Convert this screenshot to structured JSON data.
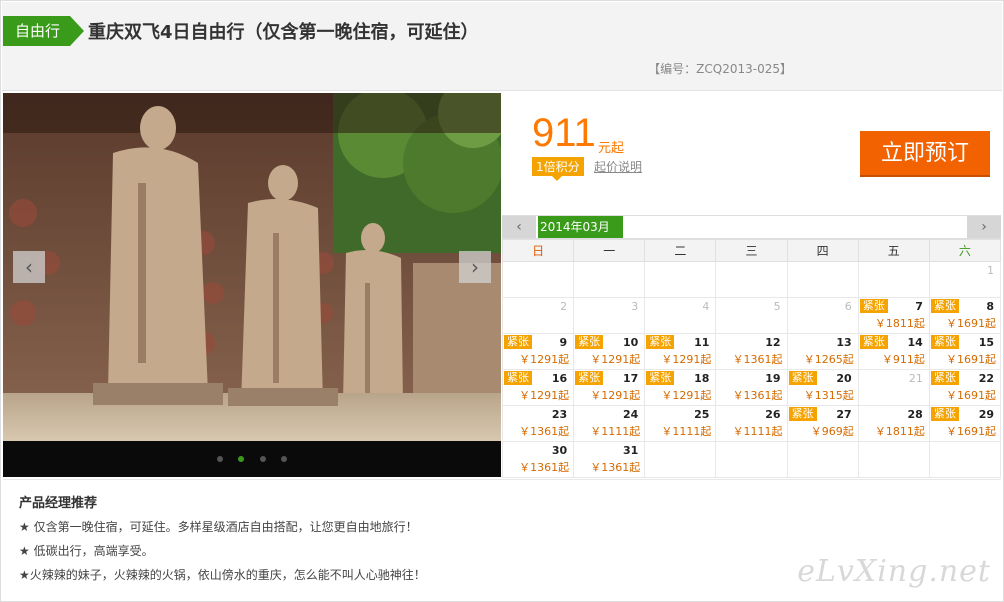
{
  "header": {
    "tag": "自由行",
    "title": "重庆双飞4日自由行（仅含第一晚住宿，可延住）",
    "code": "【编号：ZCQ2013-025】"
  },
  "gallery": {
    "prev_label": "‹",
    "next_label": "›",
    "dots": 4,
    "active_dot": 2
  },
  "price": {
    "amount": "911",
    "unit": "元起",
    "points": "1倍积分",
    "note": "起价说明",
    "book_label": "立即预订"
  },
  "calendar": {
    "prev": "‹",
    "next": "›",
    "month": "2014年03月",
    "weekdays": [
      "日",
      "一",
      "二",
      "三",
      "四",
      "五",
      "六"
    ],
    "tight_label": "紧张",
    "rows": [
      [
        null,
        null,
        null,
        null,
        null,
        null,
        {
          "day": "1",
          "off": true
        }
      ],
      [
        {
          "day": "2",
          "off": true
        },
        {
          "day": "3",
          "off": true
        },
        {
          "day": "4",
          "off": true
        },
        {
          "day": "5",
          "off": true
        },
        {
          "day": "6",
          "off": true
        },
        {
          "day": "7",
          "tight": true,
          "price": "￥1811起"
        },
        {
          "day": "8",
          "tight": true,
          "price": "￥1691起"
        }
      ],
      [
        {
          "day": "9",
          "tight": true,
          "price": "￥1291起"
        },
        {
          "day": "10",
          "tight": true,
          "price": "￥1291起"
        },
        {
          "day": "11",
          "tight": true,
          "price": "￥1291起"
        },
        {
          "day": "12",
          "price": "￥1361起"
        },
        {
          "day": "13",
          "price": "￥1265起"
        },
        {
          "day": "14",
          "tight": true,
          "price": "￥911起"
        },
        {
          "day": "15",
          "tight": true,
          "price": "￥1691起"
        }
      ],
      [
        {
          "day": "16",
          "tight": true,
          "price": "￥1291起"
        },
        {
          "day": "17",
          "tight": true,
          "price": "￥1291起"
        },
        {
          "day": "18",
          "tight": true,
          "price": "￥1291起"
        },
        {
          "day": "19",
          "price": "￥1361起"
        },
        {
          "day": "20",
          "tight": true,
          "price": "￥1315起"
        },
        {
          "day": "21",
          "off": true
        },
        {
          "day": "22",
          "tight": true,
          "price": "￥1691起"
        }
      ],
      [
        {
          "day": "23",
          "price": "￥1361起"
        },
        {
          "day": "24",
          "price": "￥1111起"
        },
        {
          "day": "25",
          "price": "￥1111起"
        },
        {
          "day": "26",
          "price": "￥1111起"
        },
        {
          "day": "27",
          "tight": true,
          "price": "￥969起"
        },
        {
          "day": "28",
          "price": "￥1811起"
        },
        {
          "day": "29",
          "tight": true,
          "price": "￥1691起"
        }
      ],
      [
        {
          "day": "30",
          "price": "￥1361起"
        },
        {
          "day": "31",
          "price": "￥1361起"
        },
        null,
        null,
        null,
        null,
        null
      ]
    ]
  },
  "recommend": {
    "title": "产品经理推荐",
    "lines": [
      "★ 仅含第一晚住宿，可延住。多样星级酒店自由搭配，让您更自由地旅行！",
      "★ 低碳出行，高端享受。",
      "★火辣辣的妹子，火辣辣的火锅，依山傍水的重庆，怎么能不叫人心驰神往！"
    ],
    "watermark": "eLvXing.net"
  }
}
